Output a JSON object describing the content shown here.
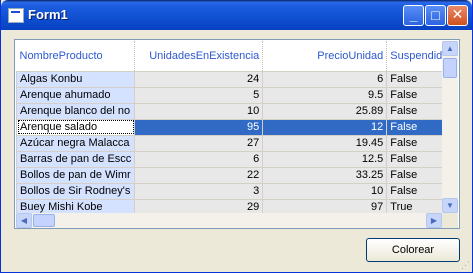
{
  "window": {
    "title": "Form1"
  },
  "caption_buttons": {
    "minimize": "_",
    "maximize": "□",
    "close": "✕"
  },
  "grid": {
    "columns": [
      "NombreProducto",
      "UnidadesEnExistencia",
      "PrecioUnidad",
      "Suspendido"
    ],
    "selected_row": 3,
    "rows": [
      [
        "Algas Konbu",
        "24",
        "6",
        "False"
      ],
      [
        "Arenque ahumado",
        "5",
        "9.5",
        "False"
      ],
      [
        "Arenque blanco del no",
        "10",
        "25.89",
        "False"
      ],
      [
        "Arenque salado",
        "95",
        "12",
        "False"
      ],
      [
        "Azúcar negra Malacca",
        "27",
        "19.45",
        "False"
      ],
      [
        "Barras de pan de Escc",
        "6",
        "12.5",
        "False"
      ],
      [
        "Bollos de pan de Wimr",
        "22",
        "33.25",
        "False"
      ],
      [
        "Bollos de Sir Rodney's",
        "3",
        "10",
        "False"
      ],
      [
        "Buey Mishi Kobe",
        "29",
        "97",
        "True"
      ]
    ]
  },
  "scrollbars": {
    "up": "▲",
    "down": "▼",
    "left": "◀",
    "right": "▶"
  },
  "button": {
    "colorear": "Colorear"
  }
}
